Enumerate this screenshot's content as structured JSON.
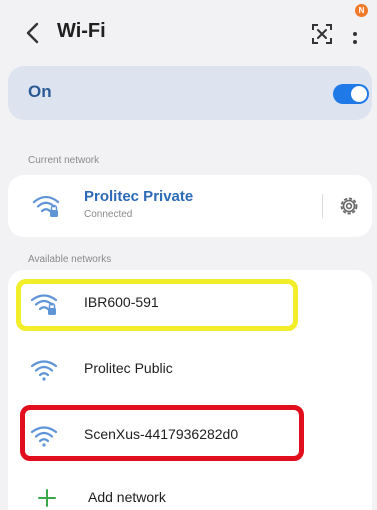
{
  "header": {
    "title": "Wi-Fi",
    "notification_badge": "N"
  },
  "wifi_toggle": {
    "label": "On",
    "state": "on",
    "accent_color": "#1f7ae8"
  },
  "current_network": {
    "section_label": "Current network",
    "name": "Prolitec Private",
    "status": "Connected",
    "secured": true
  },
  "available_networks": {
    "section_label": "Available networks",
    "items": [
      {
        "name": "IBR600-591",
        "secured": true,
        "highlight": "yellow"
      },
      {
        "name": "Prolitec Public",
        "secured": false,
        "highlight": "none"
      },
      {
        "name": "ScenXus-4417936282d0",
        "secured": false,
        "highlight": "red"
      }
    ],
    "add_label": "Add network"
  },
  "highlight_colors": {
    "yellow": "#f2ee2a",
    "red": "#e10f1e"
  },
  "icons": {
    "back": "chevron-left-icon",
    "scan": "qr-scan-icon",
    "more": "more-vertical-icon",
    "settings": "gear-icon",
    "wifi": "wifi-icon",
    "add": "plus-icon"
  }
}
